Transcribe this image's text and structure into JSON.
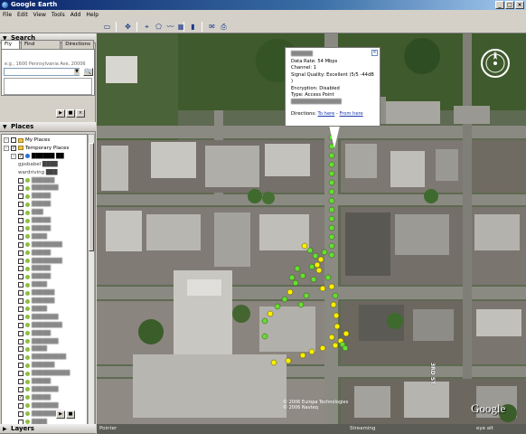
{
  "window": {
    "title": "Google Earth"
  },
  "menu": [
    "File",
    "Edit",
    "View",
    "Tools",
    "Add",
    "Help"
  ],
  "search": {
    "header": "Search",
    "tabs": [
      "Fly To",
      "Find Businesses",
      "Directions"
    ],
    "hint": "e.g., 1600 Pennsylvania Ave, 20006"
  },
  "places": {
    "header": "Places",
    "items": [
      {
        "label": "My Places",
        "level": 0,
        "type": "folder",
        "checked": false
      },
      {
        "label": "Temporary Places",
        "level": 0,
        "type": "folder",
        "checked": true
      },
      {
        "label": "██████ ██",
        "level": 1,
        "type": "file",
        "checked": true
      },
      {
        "label": "gpsbabel ████",
        "level": 2,
        "type": "text",
        "checked": false
      },
      {
        "label": "wardriving ███",
        "level": 2,
        "type": "text",
        "checked": false
      },
      {
        "label": "██████",
        "level": 2,
        "type": "pin",
        "checked": false
      },
      {
        "label": "███████",
        "level": 2,
        "type": "pin",
        "checked": false
      },
      {
        "label": "█████",
        "level": 2,
        "type": "pin",
        "checked": false
      },
      {
        "label": "█████",
        "level": 2,
        "type": "pin",
        "checked": false
      },
      {
        "label": "███",
        "level": 2,
        "type": "pin",
        "checked": false
      },
      {
        "label": "█████",
        "level": 2,
        "type": "pin",
        "checked": false
      },
      {
        "label": "█████",
        "level": 2,
        "type": "pin",
        "checked": false
      },
      {
        "label": "████",
        "level": 2,
        "type": "pin",
        "checked": false
      },
      {
        "label": "████████",
        "level": 2,
        "type": "pin",
        "checked": false
      },
      {
        "label": "█████",
        "level": 2,
        "type": "pin",
        "checked": false
      },
      {
        "label": "████████",
        "level": 2,
        "type": "pin",
        "checked": false
      },
      {
        "label": "█████",
        "level": 2,
        "type": "pin",
        "checked": false
      },
      {
        "label": "█████",
        "level": 2,
        "type": "pin",
        "checked": false
      },
      {
        "label": "████",
        "level": 2,
        "type": "pin",
        "checked": false
      },
      {
        "label": "██████",
        "level": 2,
        "type": "pin",
        "checked": false
      },
      {
        "label": "██████",
        "level": 2,
        "type": "pin",
        "checked": false
      },
      {
        "label": "████",
        "level": 2,
        "type": "pin",
        "checked": false
      },
      {
        "label": "███████",
        "level": 2,
        "type": "pin",
        "checked": false
      },
      {
        "label": "████████",
        "level": 2,
        "type": "pin",
        "checked": false
      },
      {
        "label": "█████",
        "level": 2,
        "type": "pin",
        "checked": false
      },
      {
        "label": "███████",
        "level": 2,
        "type": "pin",
        "checked": false
      },
      {
        "label": "████",
        "level": 2,
        "type": "pin",
        "checked": false
      },
      {
        "label": "█████████",
        "level": 2,
        "type": "pin",
        "checked": false
      },
      {
        "label": "██████",
        "level": 2,
        "type": "pin",
        "checked": false
      },
      {
        "label": "██████████",
        "level": 2,
        "type": "pin",
        "checked": false
      },
      {
        "label": "█████",
        "level": 2,
        "type": "pin",
        "checked": false
      },
      {
        "label": "███████",
        "level": 2,
        "type": "pin",
        "checked": false
      },
      {
        "label": "█████",
        "level": 2,
        "type": "pin",
        "checked": true
      },
      {
        "label": "███████",
        "level": 2,
        "type": "pin",
        "checked": false
      },
      {
        "label": "████████",
        "level": 2,
        "type": "pin",
        "checked": false
      },
      {
        "label": "████",
        "level": 2,
        "type": "pin",
        "checked": false
      },
      {
        "label": "███████████",
        "level": 2,
        "type": "pin",
        "checked": false
      },
      {
        "label": "█████",
        "level": 2,
        "type": "pin",
        "checked": false
      }
    ]
  },
  "layers": {
    "header": "Layers"
  },
  "balloon": {
    "title": "██████",
    "lines": [
      "Data Rate: 54 Mbps",
      "Channel: 1",
      "Signal Quality: Excellent (5/5 -44dB )",
      "Encryption: Disabled",
      "Type: Access Point"
    ],
    "blurred_line": "██████████████",
    "directions_label": "Directions:",
    "to_here": "To here",
    "from_here": "From here"
  },
  "map": {
    "street_label": "3RD ST",
    "copyright": [
      "© 2006 Europa Technologies",
      "© 2006 Navteq"
    ],
    "logo": "Google"
  },
  "statusbar": {
    "pointer": "Pointer",
    "streaming": "Streaming",
    "eye_alt": "eye alt"
  },
  "colors": {
    "point_green": "#66dd33",
    "point_yellow": "#ffee00",
    "balloon_link": "#1a3ab0"
  }
}
